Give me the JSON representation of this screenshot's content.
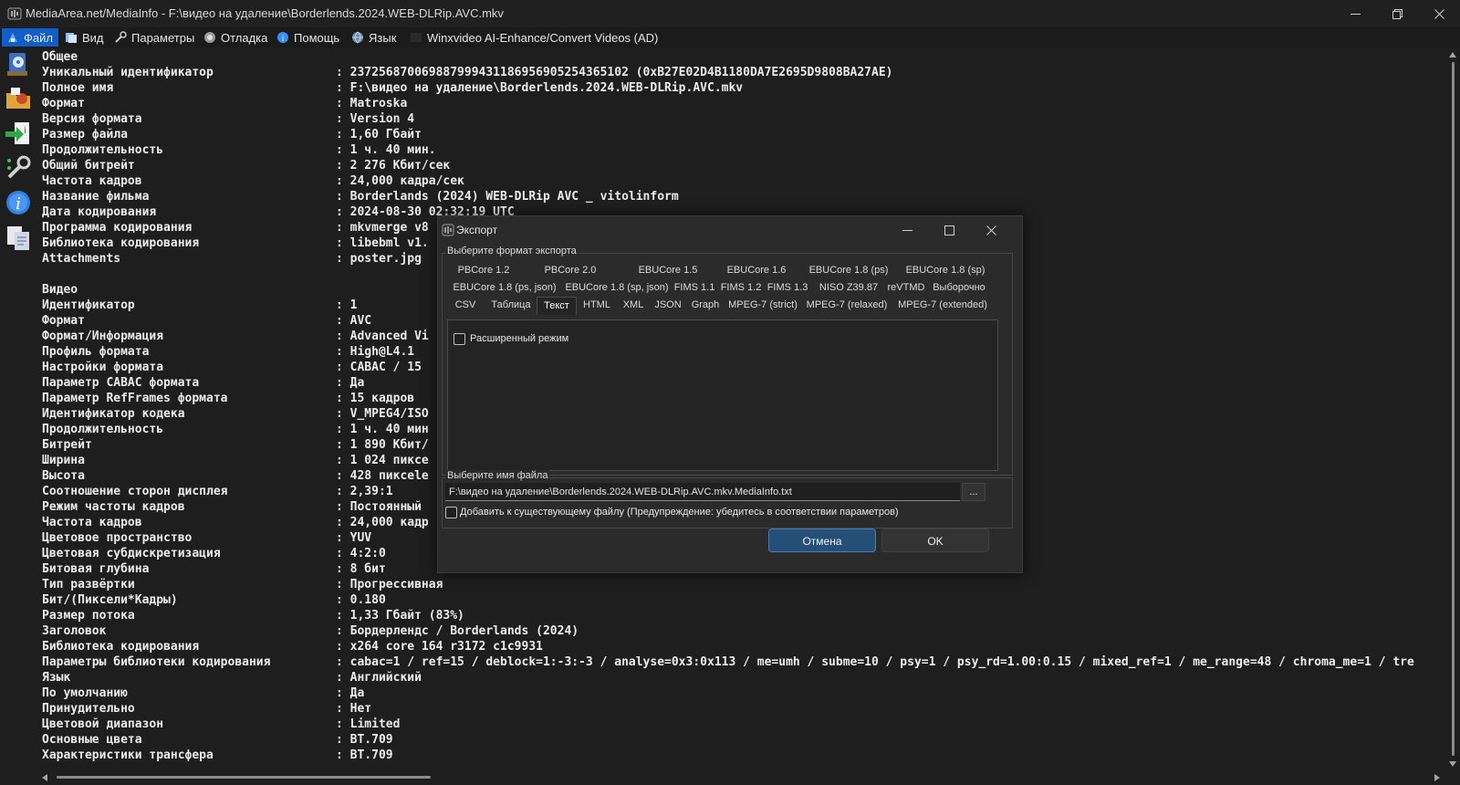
{
  "window": {
    "title": "MediaArea.net/MediaInfo - F:\\видео на удаление\\Borderlends.2024.WEB-DLRip.AVC.mkv"
  },
  "menu": [
    {
      "label": "Файл",
      "icon": "file-icon"
    },
    {
      "label": "Вид",
      "icon": "view-icon"
    },
    {
      "label": "Параметры",
      "icon": "settings-icon"
    },
    {
      "label": "Отладка",
      "icon": "debug-icon"
    },
    {
      "label": "Помощь",
      "icon": "help-icon"
    },
    {
      "label": "Язык",
      "icon": "globe-icon"
    },
    {
      "label": "Winxvideo AI-Enhance/Convert Videos (AD)",
      "icon": ""
    }
  ],
  "lines": [
    {
      "k": "Общее",
      "v": ""
    },
    {
      "k": "Уникальный идентификатор",
      "v": ": 237256870069887999431186956905254365102 (0xB27E02D4B1180DA7E2695D9808BA27AE)"
    },
    {
      "k": "Полное имя",
      "v": ": F:\\видео на удаление\\Borderlends.2024.WEB-DLRip.AVC.mkv"
    },
    {
      "k": "Формат",
      "v": ": Matroska"
    },
    {
      "k": "Версия формата",
      "v": ": Version 4"
    },
    {
      "k": "Размер файла",
      "v": ": 1,60 Гбайт"
    },
    {
      "k": "Продолжительность",
      "v": ": 1 ч. 40 мин."
    },
    {
      "k": "Общий битрейт",
      "v": ": 2 276 Кбит/сек"
    },
    {
      "k": "Частота кадров",
      "v": ": 24,000 кадра/сек"
    },
    {
      "k": "Название фильма",
      "v": ": Borderlands (2024) WEB-DLRip AVC _ vitolinform"
    },
    {
      "k": "Дата кодирования",
      "v": ": 2024-08-30 02:32:19 UTC"
    },
    {
      "k": "Программа кодирования",
      "v": ": mkvmerge v8"
    },
    {
      "k": "Библиотека кодирования",
      "v": ": libebml v1."
    },
    {
      "k": "Attachments",
      "v": ": poster.jpg"
    },
    {
      "k": "",
      "v": ""
    },
    {
      "k": "Видео",
      "v": ""
    },
    {
      "k": "Идентификатор",
      "v": ": 1"
    },
    {
      "k": "Формат",
      "v": ": AVC"
    },
    {
      "k": "Формат/Информация",
      "v": ": Advanced Vi"
    },
    {
      "k": "Профиль формата",
      "v": ": High@L4.1"
    },
    {
      "k": "Настройки формата",
      "v": ": CABAC / 15"
    },
    {
      "k": "Параметр CABAC формата",
      "v": ": Да"
    },
    {
      "k": "Параметр RefFrames формата",
      "v": ": 15 кадров"
    },
    {
      "k": "Идентификатор кодека",
      "v": ": V_MPEG4/ISO"
    },
    {
      "k": "Продолжительность",
      "v": ": 1 ч. 40 мин"
    },
    {
      "k": "Битрейт",
      "v": ": 1 890 Кбит/"
    },
    {
      "k": "Ширина",
      "v": ": 1 024 пиксе"
    },
    {
      "k": "Высота",
      "v": ": 428 пиксele"
    },
    {
      "k": "Соотношение сторон дисплея",
      "v": ": 2,39:1"
    },
    {
      "k": "Режим частоты кадров",
      "v": ": Постоянный"
    },
    {
      "k": "Частота кадров",
      "v": ": 24,000 кадр"
    },
    {
      "k": "Цветовое пространство",
      "v": ": YUV"
    },
    {
      "k": "Цветовая субдискретизация",
      "v": ": 4:2:0"
    },
    {
      "k": "Битовая глубина",
      "v": ": 8 бит"
    },
    {
      "k": "Тип развёртки",
      "v": ": Прогрессивная"
    },
    {
      "k": "Бит/(Пиксели*Кадры)",
      "v": ": 0.180"
    },
    {
      "k": "Размер потока",
      "v": ": 1,33 Гбайт (83%)"
    },
    {
      "k": "Заголовок",
      "v": ": Бордерлендс / Borderlands (2024)"
    },
    {
      "k": "Библиотека кодирования",
      "v": ": x264 core 164 r3172 c1c9931"
    },
    {
      "k": "Параметры библиотеки кодирования",
      "v": ": cabac=1 / ref=15 / deblock=1:-3:-3 / analyse=0x3:0x113 / me=umh / subme=10 / psy=1 / psy_rd=1.00:0.15 / mixed_ref=1 / me_range=48 / chroma_me=1 / tre"
    },
    {
      "k": "Язык",
      "v": ": Английский"
    },
    {
      "k": "По умолчанию",
      "v": ": Да"
    },
    {
      "k": "Принудительно",
      "v": ": Нет"
    },
    {
      "k": "Цветовой диапазон",
      "v": ": Limited"
    },
    {
      "k": "Основные цвета",
      "v": ": BT.709"
    },
    {
      "k": "Характеристики трансфера",
      "v": ": BT.709"
    }
  ],
  "dialog": {
    "title": "Экспорт",
    "format_group_label": "Выберите формат экспорта",
    "tabs_row1": [
      "PBCore 1.2",
      "PBCore 2.0",
      "EBUCore 1.5",
      "EBUCore 1.6",
      "EBUCore 1.8 (ps)",
      "EBUCore 1.8 (sp)"
    ],
    "tabs_row2": [
      "EBUCore 1.8 (ps, json)",
      "EBUCore 1.8 (sp, json)",
      "FIMS 1.1",
      "FIMS 1.2",
      "FIMS 1.3",
      "NISO Z39.87",
      "reVTMD",
      "Выборочно"
    ],
    "tabs_row3": [
      "CSV",
      "Таблица",
      "Текст",
      "HTML",
      "XML",
      "JSON",
      "Graph",
      "MPEG-7 (strict)",
      "MPEG-7 (relaxed)",
      "MPEG-7 (extended)"
    ],
    "selected_tab": "Текст",
    "advanced_mode_label": "Расширенный режим",
    "advanced_mode_checked": false,
    "file_group_label": "Выберите имя файла",
    "file_value": "F:\\видео на удаление\\Borderlends.2024.WEB-DLRip.AVC.mkv.MediaInfo.txt",
    "browse_label": "...",
    "append_label": "Добавить к существующему файлу (Предупреждение: убедитесь в соответствии параметров)",
    "append_checked": false,
    "cancel_label": "Отмена",
    "ok_label": "OK"
  },
  "colors": {
    "background": "#1e1e1e",
    "accent": "#0f5ec9",
    "primary_button": "#264f78"
  }
}
